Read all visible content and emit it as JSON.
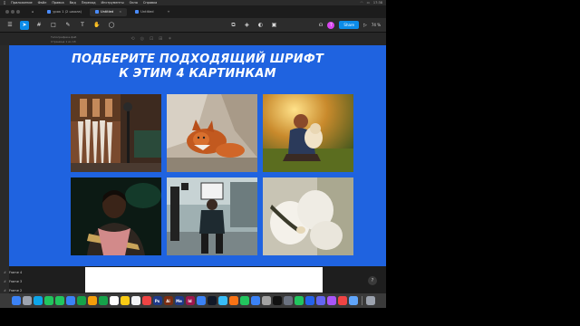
{
  "menubar": {
    "items": [
      "Приложение",
      "Файл",
      "Правка",
      "Вид",
      "Переход",
      "Инструменты",
      "Окно",
      "Справка"
    ],
    "clock": "17:38"
  },
  "tabs": [
    {
      "label": "урок 1 (2 школа)"
    },
    {
      "label": "Untitled"
    },
    {
      "label": "Untitled"
    }
  ],
  "toolbar": {
    "avatar_letter": "T",
    "share_label": "Share",
    "zoom": "74 %"
  },
  "file": {
    "name": "Типографика.фиб",
    "page": "Страница 1 из 18"
  },
  "canvas": {
    "background": "#1f63e0",
    "headline_line1": "ПОДБЕРИТЕ ПОДХОДЯЩИЙ ШРИФТ",
    "headline_line2": "К ЭТИМ 4 КАРТИНКАМ"
  },
  "layers": [
    "Frame 4",
    "Frame 3",
    "Frame 2"
  ],
  "help_label": "?",
  "dock": {
    "apps": [
      {
        "name": "finder",
        "color": "#3b82f6",
        "label": ""
      },
      {
        "name": "launchpad",
        "color": "#9ca3af",
        "label": ""
      },
      {
        "name": "safari",
        "color": "#0ea5e9",
        "label": ""
      },
      {
        "name": "chrome",
        "color": "#22c55e",
        "label": ""
      },
      {
        "name": "messages",
        "color": "#22c55e",
        "label": ""
      },
      {
        "name": "mail",
        "color": "#3b82f6",
        "label": ""
      },
      {
        "name": "maps",
        "color": "#16a34a",
        "label": ""
      },
      {
        "name": "photos",
        "color": "#f59e0b",
        "label": ""
      },
      {
        "name": "facetime",
        "color": "#16a34a",
        "label": ""
      },
      {
        "name": "calendar",
        "color": "#ffffff",
        "label": ""
      },
      {
        "name": "notes",
        "color": "#facc15",
        "label": ""
      },
      {
        "name": "reminders",
        "color": "#f3f4f6",
        "label": ""
      },
      {
        "name": "music",
        "color": "#ef4444",
        "label": ""
      },
      {
        "name": "photoshop",
        "color": "#1e3a8a",
        "label": "Ps"
      },
      {
        "name": "illustrator",
        "color": "#7c2d12",
        "label": "Ai"
      },
      {
        "name": "media-encoder",
        "color": "#1e3a8a",
        "label": "Me"
      },
      {
        "name": "indesign",
        "color": "#9d174d",
        "label": "Id"
      },
      {
        "name": "app-store",
        "color": "#3b82f6",
        "label": ""
      },
      {
        "name": "figma",
        "color": "#111827",
        "label": ""
      },
      {
        "name": "telegram",
        "color": "#38bdf8",
        "label": ""
      },
      {
        "name": "pages",
        "color": "#f97316",
        "label": ""
      },
      {
        "name": "numbers",
        "color": "#22c55e",
        "label": ""
      },
      {
        "name": "keynote",
        "color": "#3b82f6",
        "label": ""
      },
      {
        "name": "preview",
        "color": "#a3a3a3",
        "label": ""
      },
      {
        "name": "terminal",
        "color": "#111111",
        "label": ""
      },
      {
        "name": "system-settings",
        "color": "#6b7280",
        "label": ""
      },
      {
        "name": "whatsapp",
        "color": "#22c55e",
        "label": ""
      },
      {
        "name": "zoom",
        "color": "#2563eb",
        "label": ""
      },
      {
        "name": "discord",
        "color": "#6366f1",
        "label": ""
      },
      {
        "name": "figma-2",
        "color": "#a855f7",
        "label": ""
      },
      {
        "name": "chrome-2",
        "color": "#ef4444",
        "label": ""
      },
      {
        "name": "finder-2",
        "color": "#60a5fa",
        "label": ""
      }
    ],
    "trash_color": "#9ca3af"
  }
}
